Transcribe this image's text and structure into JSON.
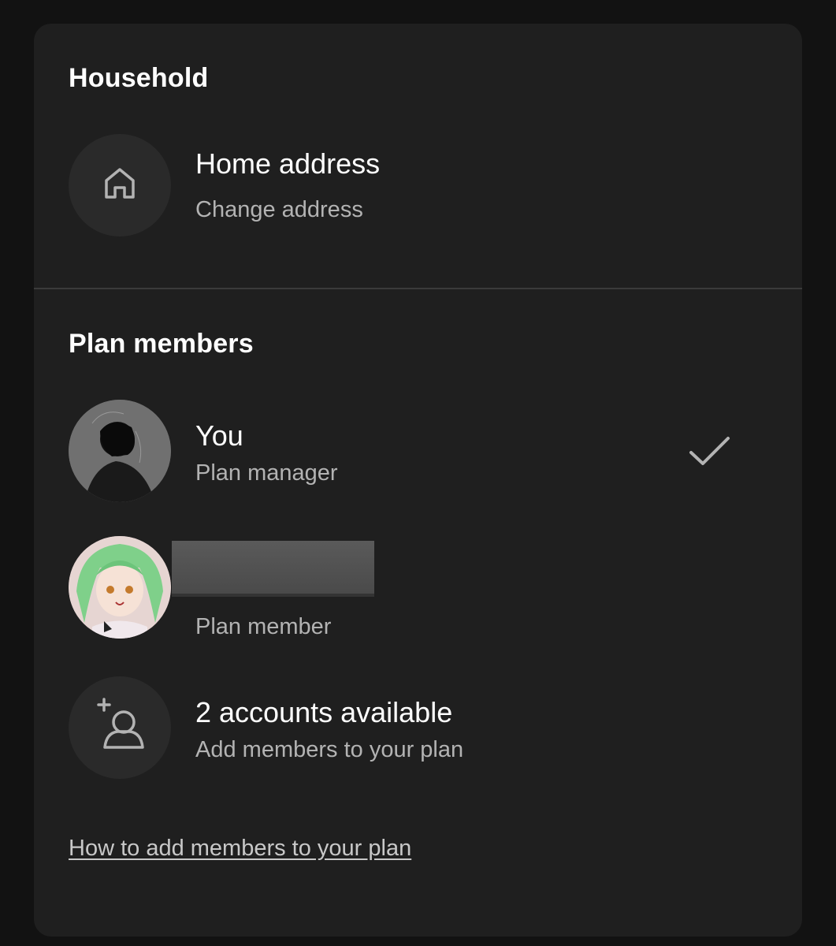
{
  "household": {
    "title": "Household",
    "home_address": {
      "label": "Home address",
      "action": "Change address",
      "icon": "home-icon"
    }
  },
  "plan_members": {
    "title": "Plan members",
    "members": [
      {
        "name": "You",
        "role": "Plan manager",
        "selected": true
      },
      {
        "name": "",
        "role": "Plan member",
        "selected": false
      }
    ],
    "add": {
      "label": "2 accounts available",
      "sub": "Add members to your plan",
      "icon": "add-user-icon"
    },
    "help_link": "How to add members to your plan"
  },
  "colors": {
    "background": "#121212",
    "card": "#1f1f1f",
    "text_primary": "#ffffff",
    "text_secondary": "#b3b3b3"
  }
}
